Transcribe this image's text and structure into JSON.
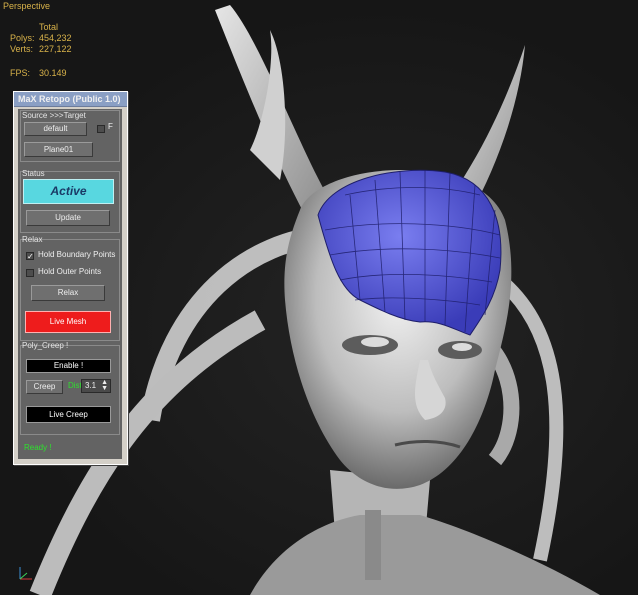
{
  "viewport": {
    "label": "Perspective",
    "stats": {
      "header": "Total",
      "polys_label": "Polys:",
      "polys": "454,232",
      "verts_label": "Verts:",
      "verts": "227,122",
      "fps_label": "FPS:",
      "fps": "30.149"
    }
  },
  "panel": {
    "title": "MaX Retopo   (Public 1.0)",
    "source_target": {
      "group_label": "Source >>>Target",
      "source_button": "default",
      "flag_label": "F",
      "target_button": "Plane01"
    },
    "status": {
      "group_label": "Status",
      "state": "Active",
      "update_button": "Update"
    },
    "relax": {
      "group_label": "Relax",
      "hold_boundary_label": "Hold Boundary Points",
      "hold_boundary_checked": true,
      "hold_outer_label": "Hold Outer Points",
      "hold_outer_checked": false,
      "relax_button": "Relax",
      "live_mesh_button": "Live Mesh"
    },
    "poly_creep": {
      "group_label": "Poly_Creep !",
      "enable_button": "Enable !",
      "creep_button": "Creep",
      "dist_label": "Dist",
      "dist_value": "3.1",
      "live_creep_button": "Live Creep"
    },
    "status_text": "Ready !"
  },
  "colors": {
    "stats_text": "#d8b24a",
    "active_status": "#58d7e0",
    "live_mesh": "#ee1c1c",
    "retopo_mesh": "#4b4fd0",
    "ready_text": "#2ee02e"
  }
}
